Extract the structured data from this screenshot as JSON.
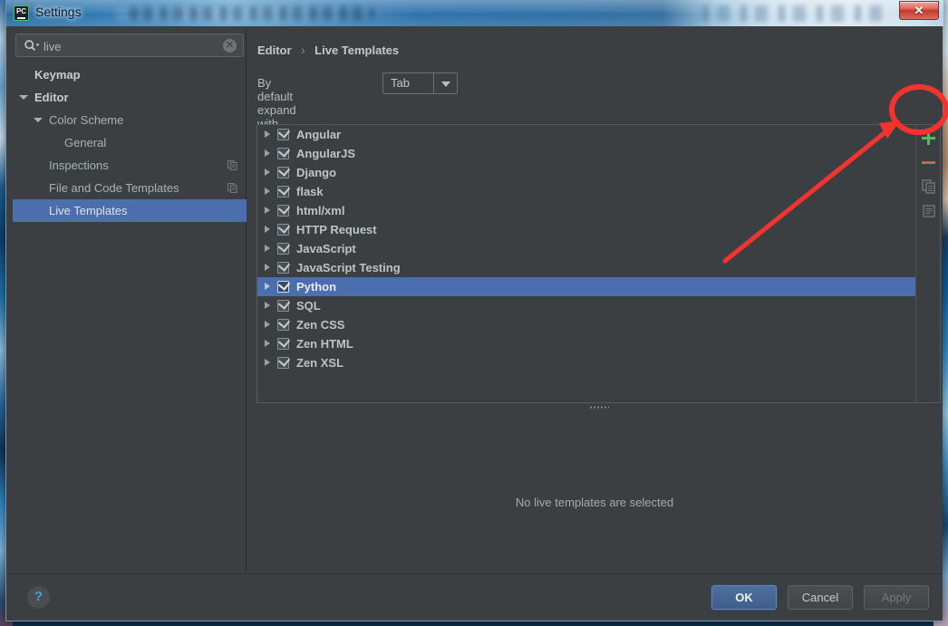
{
  "window": {
    "title": "Settings",
    "app_icon": "pycharm-icon",
    "close_label": "✕"
  },
  "sidebar": {
    "search": {
      "value": "live",
      "placeholder": "",
      "icon": "search-icon",
      "clear_icon": "clear-icon"
    },
    "items": [
      {
        "label": "Keymap",
        "indent": 24,
        "twisty": "none",
        "bold": true,
        "selected": false,
        "scope_icon": false
      },
      {
        "label": "Editor",
        "indent": 24,
        "twisty": "expanded",
        "bold": true,
        "selected": false,
        "scope_icon": false
      },
      {
        "label": "Color Scheme",
        "indent": 40,
        "twisty": "expanded",
        "bold": false,
        "selected": false,
        "scope_icon": false
      },
      {
        "label": "General",
        "indent": 57,
        "twisty": "none",
        "bold": false,
        "selected": false,
        "scope_icon": false
      },
      {
        "label": "Inspections",
        "indent": 40,
        "twisty": "none",
        "bold": false,
        "selected": false,
        "scope_icon": true
      },
      {
        "label": "File and Code Templates",
        "indent": 40,
        "twisty": "none",
        "bold": false,
        "selected": false,
        "scope_icon": true
      },
      {
        "label": "Live Templates",
        "indent": 40,
        "twisty": "none",
        "bold": false,
        "selected": true,
        "scope_icon": false
      }
    ]
  },
  "main": {
    "breadcrumb": {
      "parent": "Editor",
      "separator": "›",
      "current": "Live Templates"
    },
    "expand_with": {
      "label": "By default expand with",
      "value": "Tab",
      "caret_icon": "chevron-down-icon"
    },
    "templates": [
      {
        "label": "Angular",
        "checked": true,
        "selected": false
      },
      {
        "label": "AngularJS",
        "checked": true,
        "selected": false
      },
      {
        "label": "Django",
        "checked": true,
        "selected": false
      },
      {
        "label": "flask",
        "checked": true,
        "selected": false
      },
      {
        "label": "html/xml",
        "checked": true,
        "selected": false
      },
      {
        "label": "HTTP Request",
        "checked": true,
        "selected": false
      },
      {
        "label": "JavaScript",
        "checked": true,
        "selected": false
      },
      {
        "label": "JavaScript Testing",
        "checked": true,
        "selected": false
      },
      {
        "label": "Python",
        "checked": true,
        "selected": true
      },
      {
        "label": "SQL",
        "checked": true,
        "selected": false
      },
      {
        "label": "Zen CSS",
        "checked": true,
        "selected": false
      },
      {
        "label": "Zen HTML",
        "checked": true,
        "selected": false
      },
      {
        "label": "Zen XSL",
        "checked": true,
        "selected": false
      }
    ],
    "toolbar": [
      {
        "name": "add-button",
        "icon": "plus-icon",
        "color": "#57b85c"
      },
      {
        "name": "remove-button",
        "icon": "minus-icon",
        "color": "#c0655e"
      },
      {
        "name": "duplicate-button",
        "icon": "copy-icon",
        "color": "#8a9194"
      },
      {
        "name": "document-button",
        "icon": "document-icon",
        "color": "#8a9194"
      }
    ],
    "empty_message": "No live templates are selected"
  },
  "footer": {
    "help_label": "?",
    "ok_label": "OK",
    "cancel_label": "Cancel",
    "apply_label": "Apply"
  },
  "annotation": {
    "circle_color": "#f5332e",
    "arrow_color": "#f5332e"
  }
}
